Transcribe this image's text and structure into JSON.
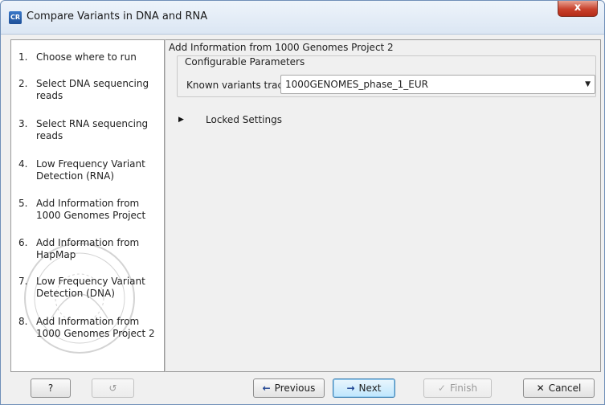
{
  "window": {
    "title": "Compare Variants in DNA and RNA",
    "app_icon_text": "CR",
    "close_glyph": "x",
    "accent_color": "#6f8fb8"
  },
  "steps": [
    {
      "num": "1.",
      "label": "Choose where to run"
    },
    {
      "num": "2.",
      "label": "Select DNA sequencing reads"
    },
    {
      "num": "3.",
      "label": "Select RNA sequencing reads"
    },
    {
      "num": "4.",
      "label": "Low Frequency Variant Detection (RNA)"
    },
    {
      "num": "5.",
      "label": "Add Information from 1000 Genomes Project"
    },
    {
      "num": "6.",
      "label": "Add Information from HapMap"
    },
    {
      "num": "7.",
      "label": "Low Frequency Variant Detection (DNA)"
    },
    {
      "num": "8.",
      "label": "Add Information from 1000 Genomes Project 2"
    }
  ],
  "content": {
    "header": "Add Information from 1000 Genomes Project 2",
    "group_title": "Configurable Parameters",
    "known_variants_label": "Known variants track",
    "known_variants_value": "1000GENOMES_phase_1_EUR",
    "locked_settings_label": "Locked Settings"
  },
  "buttons": {
    "help": "?",
    "reset": "↺",
    "previous": "Previous",
    "next": "Next",
    "finish": "Finish",
    "cancel": "Cancel"
  },
  "icons": {
    "previous": "arrow-left-icon",
    "next": "arrow-right-icon",
    "finish": "checkmark-icon",
    "cancel": "x-icon",
    "dropdown": "chevron-down-icon",
    "expand": "triangle-right-icon"
  }
}
